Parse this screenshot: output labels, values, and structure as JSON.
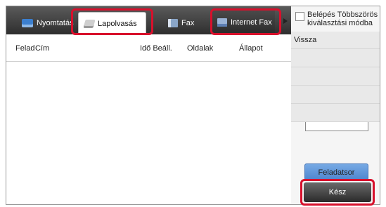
{
  "tabs": {
    "print": "Nyomtatás",
    "scan": "Lapolvasás",
    "fax": "Fax",
    "internet_fax": "Internet Fax"
  },
  "columns": {
    "sender": "Felad",
    "title": "Cím",
    "time": "Idő Beáll.",
    "pages": "Oldalak",
    "status": "Állapot"
  },
  "right_panel": {
    "multi_select_label": "Belépés Többszörös kiválasztási módba",
    "back": "Vissza",
    "job_queue": "Feladatsor",
    "done": "Kész"
  },
  "colors": {
    "highlight": "#d8102c",
    "tab_bar": "#3a3a3a",
    "queue_button": "#5f93d8"
  }
}
